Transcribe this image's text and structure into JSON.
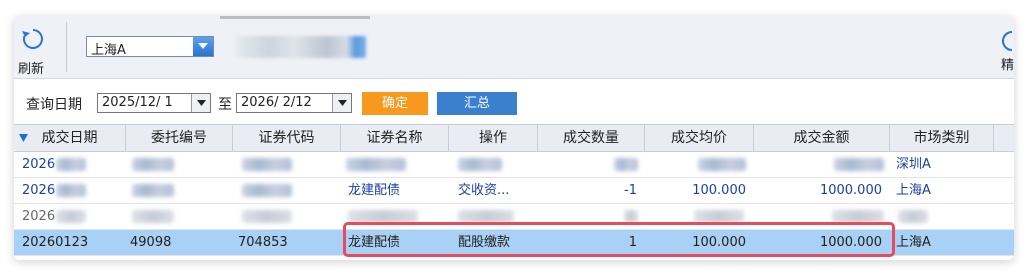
{
  "toolbar": {
    "refresh_label": "刷新",
    "account": "上海A",
    "right_label": "精"
  },
  "query": {
    "label": "查询日期",
    "start_date": "2025/12/ 1",
    "to_label": "至",
    "end_date": "2026/ 2/12",
    "confirm_label": "确定",
    "summary_label": "汇总"
  },
  "table": {
    "headers": [
      "成交日期",
      "委托编号",
      "证券代码",
      "证券名称",
      "操作",
      "成交数量",
      "成交均价",
      "成交金额",
      "市场类别"
    ],
    "rows": [
      {
        "date": "2026",
        "order_no": "",
        "code": "",
        "name": "",
        "op": "",
        "qty": "",
        "price": "",
        "amount": "",
        "market": "深圳A"
      },
      {
        "date": "2026",
        "order_no": "",
        "code": "",
        "name": "龙建配债",
        "op": "交收资...",
        "qty": "-1",
        "price": "100.000",
        "amount": "1000.000",
        "market": "上海A"
      },
      {
        "date": "2026",
        "order_no": "",
        "code": "",
        "name": "",
        "op": "",
        "qty": "",
        "price": "",
        "amount": "",
        "market": ""
      },
      {
        "date": "20260123",
        "order_no": "49098",
        "code": "704853",
        "name": "龙建配债",
        "op": "配股缴款",
        "qty": "1",
        "price": "100.000",
        "amount": "1000.000",
        "market": "上海A"
      }
    ]
  },
  "colors": {
    "accent_orange": "#f6991d",
    "accent_blue": "#3b7fcf",
    "selected_row": "#a8d1f5",
    "highlight_border": "#e84a60"
  }
}
